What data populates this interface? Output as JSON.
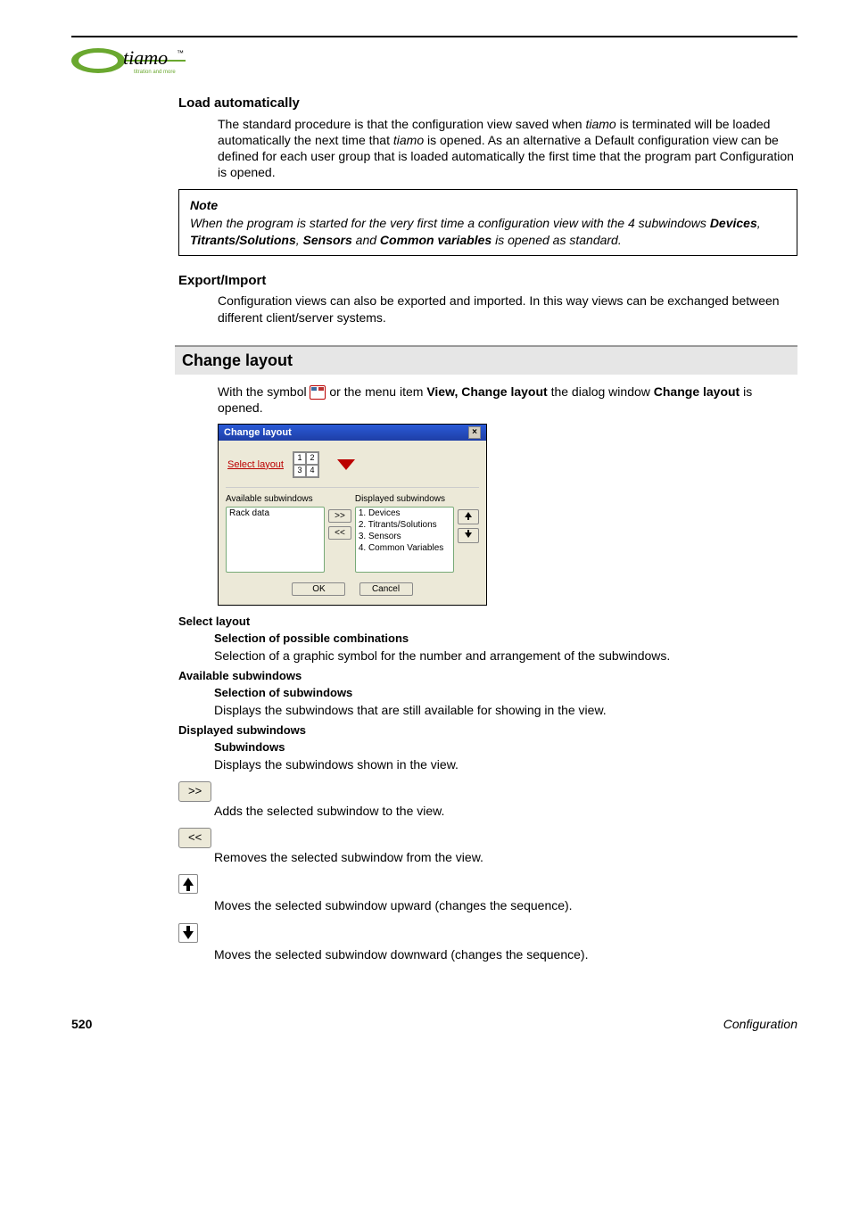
{
  "logo": {
    "brand": "tiamo",
    "tm": "™",
    "tagline": "titration and more"
  },
  "h_load": "Load automatically",
  "p_load": "The standard procedure is that the configuration view saved when tiamo is terminated will be loaded automatically the next time that tiamo is opened. As an alternative a Default configuration view can be defined for each user group that is loaded automatically the first time that the program part Configuration is opened.",
  "note": {
    "title": "Note",
    "pre": "When the program is started for the very first time a configuration view with the 4 subwindows ",
    "b1": "Devices",
    "c1": ", ",
    "b2": "Titrants/Solutions",
    "c2": ", ",
    "b3": "Sensors",
    "mid": " and ",
    "b4": "Common variables",
    "post": " is opened as standard."
  },
  "h_export": "Export/Import",
  "p_export": "Configuration views can also be exported and imported. In this way views can be exchanged between different client/server systems.",
  "h_change": "Change layout",
  "p_change_pre": "With the symbol ",
  "p_change_mid": " or the menu item ",
  "p_change_menu": "View, Change layout",
  "p_change_mid2": " the dialog window ",
  "p_change_dlg": "Change layout",
  "p_change_post": " is opened.",
  "dialog": {
    "title": "Change layout",
    "selectLabel": "Select layout",
    "grid": [
      "1",
      "2",
      "3",
      "4"
    ],
    "availHdr": "Available subwindows",
    "dispHdr": "Displayed subwindows",
    "availItems": [
      "Rack data"
    ],
    "dispItems": [
      "1. Devices",
      "2. Titrants/Solutions",
      "3. Sensors",
      "4. Common Variables"
    ],
    "add": ">>",
    "remove": "<<",
    "ok": "OK",
    "cancel": "Cancel"
  },
  "desc": {
    "sl_h": "Select layout",
    "sl_sub": "Selection of possible combinations",
    "sl_p": "Selection of a graphic symbol for the number and arrangement of the subwindows.",
    "av_h": "Available subwindows",
    "av_sub": "Selection of subwindows",
    "av_p": "Displays the subwindows that are still available for showing in the view.",
    "ds_h": "Displayed subwindows",
    "ds_sub": "Subwindows",
    "ds_p": "Displays the subwindows shown in the view.",
    "add_btn": ">>",
    "add_p": "Adds the selected subwindow to the view.",
    "rem_btn": "<<",
    "rem_p": "Removes the selected subwindow from the view.",
    "up_p": "Moves the selected subwindow upward (changes the sequence).",
    "down_p": "Moves the selected subwindow downward (changes the sequence)."
  },
  "foot": {
    "page": "520",
    "section": "Configuration"
  }
}
